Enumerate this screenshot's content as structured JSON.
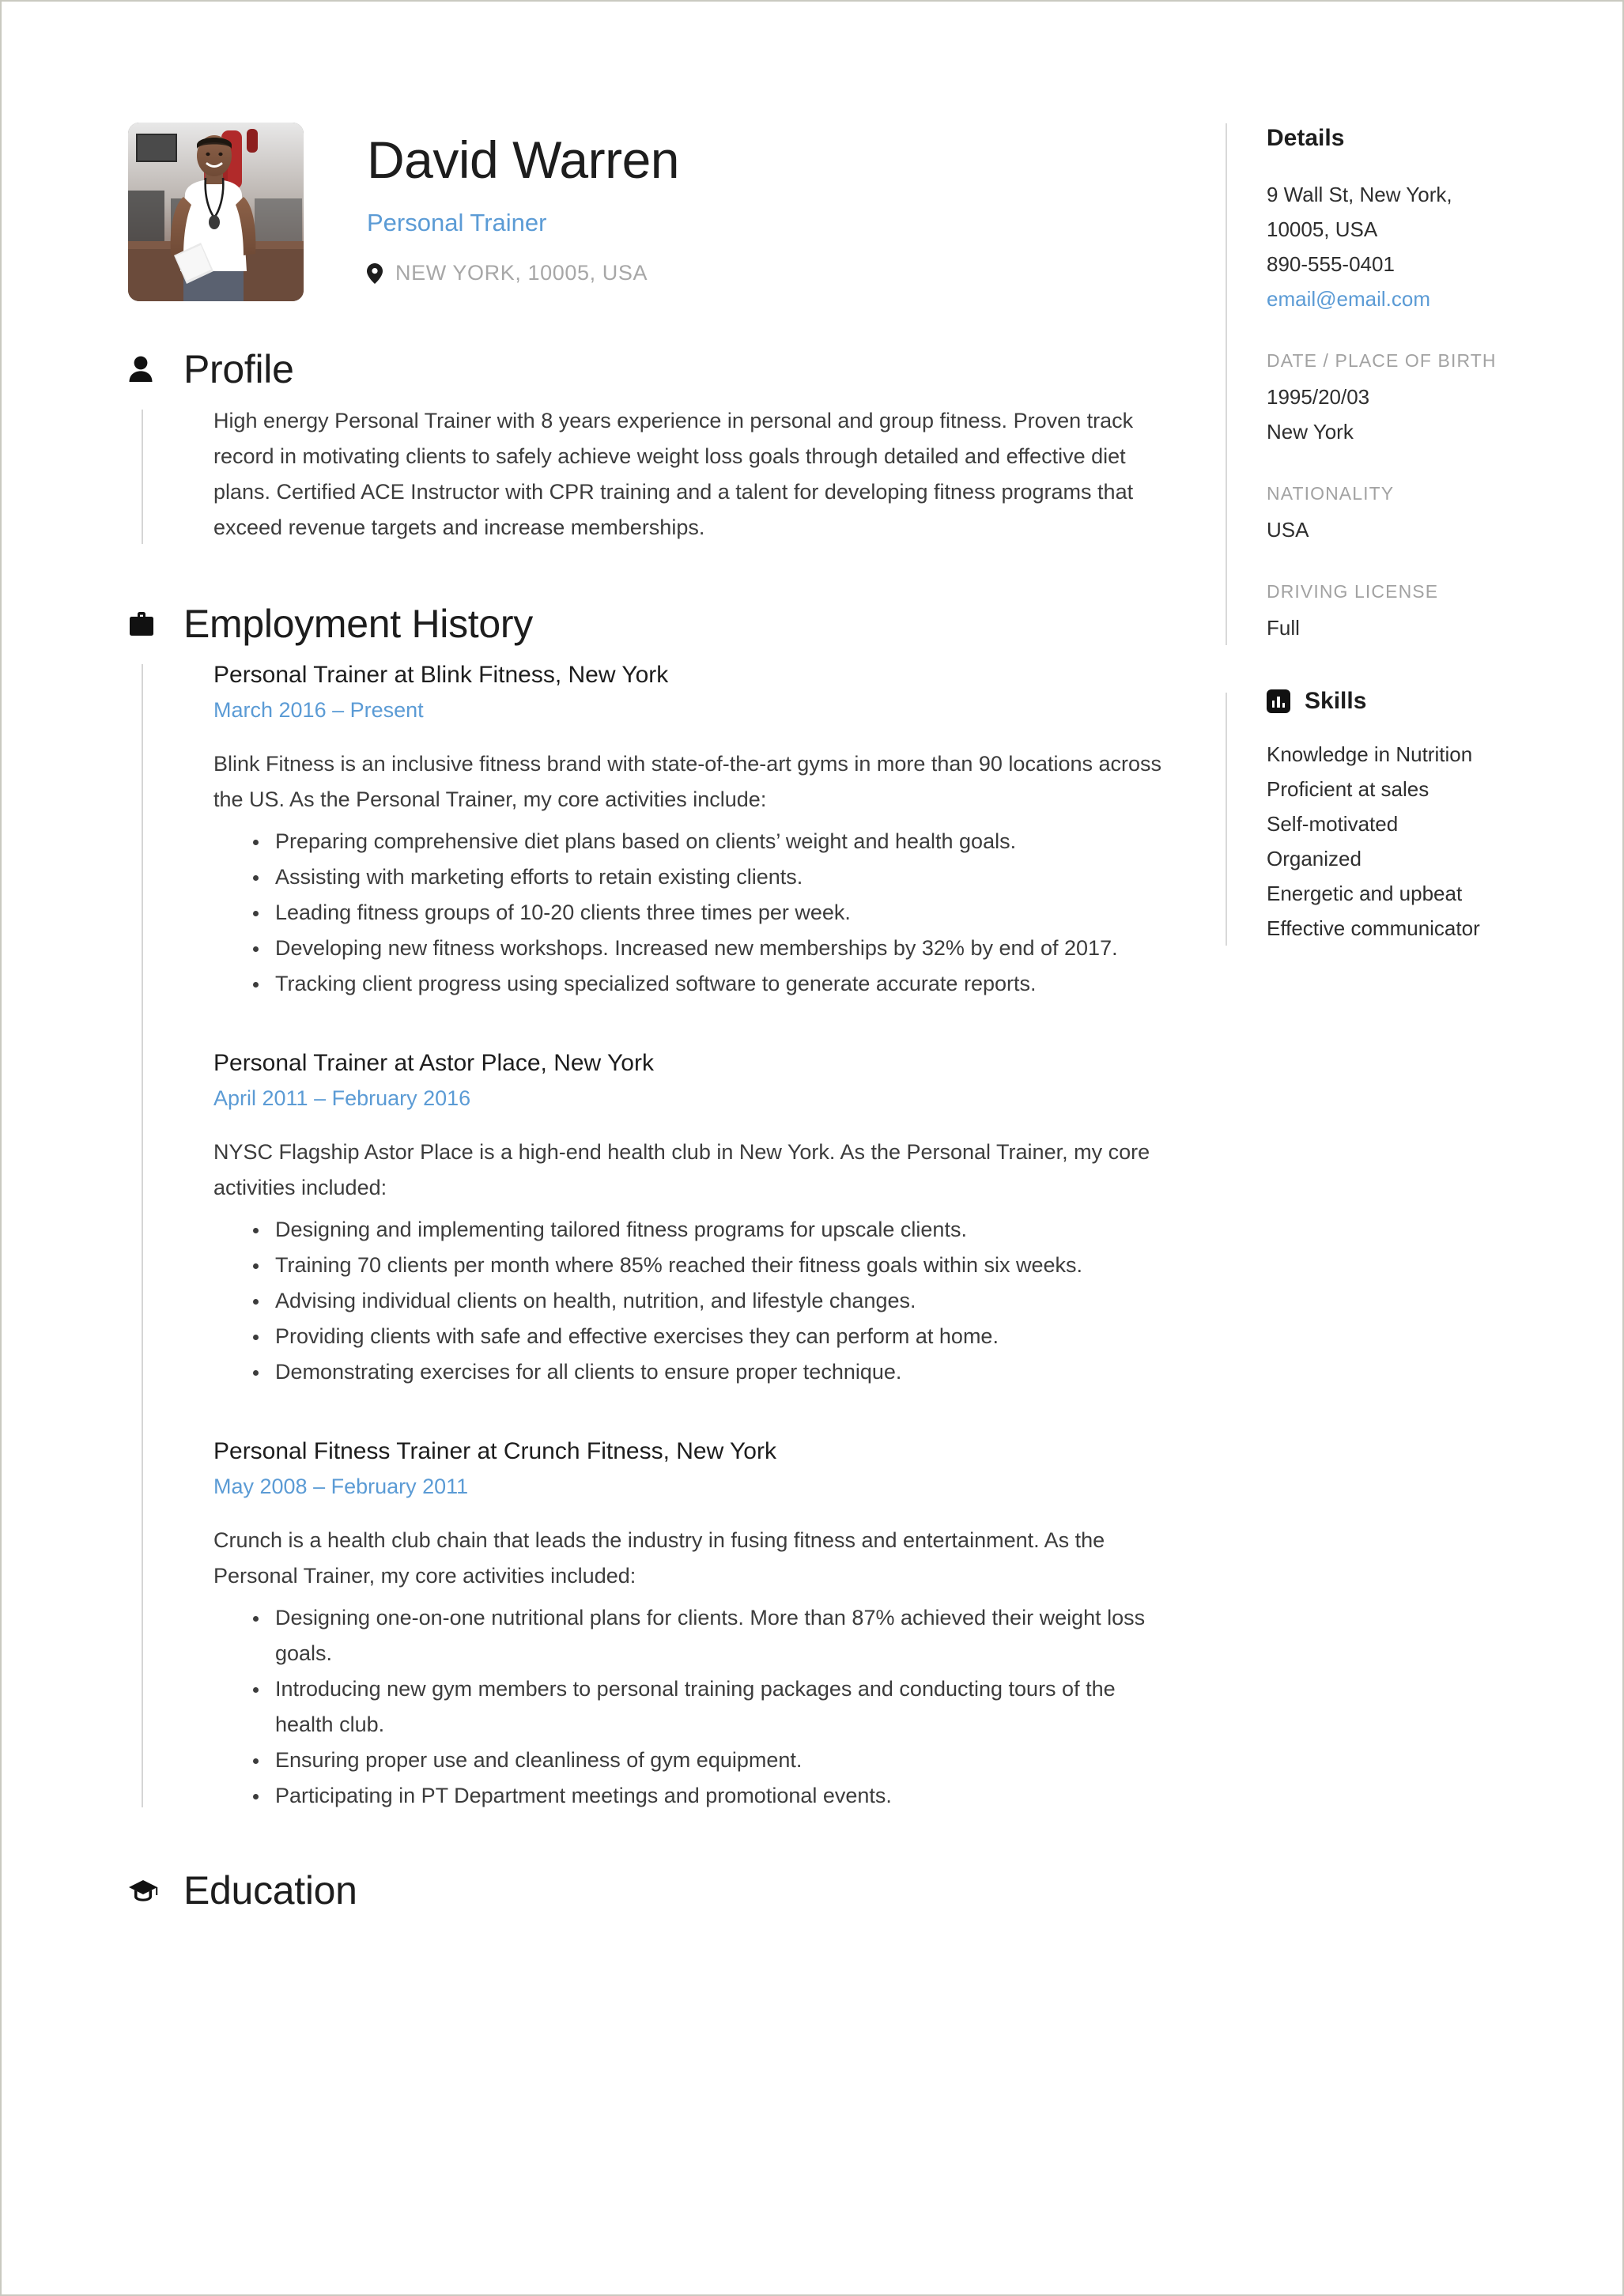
{
  "header": {
    "full_name": "David Warren",
    "job_title": "Personal Trainer",
    "location": "NEW YORK, 10005, USA",
    "pin_icon": "location-pin-icon",
    "avatar_alt": "photo of man in white t-shirt in a gym"
  },
  "profile": {
    "section_title": "Profile",
    "icon": "person-icon",
    "text": "High energy Personal Trainer with 8 years experience in personal and group fitness. Proven track record in motivating clients to safely achieve weight loss goals through detailed and effective diet plans. Certified ACE Instructor with CPR training and a talent for developing fitness programs that exceed revenue targets and increase memberships."
  },
  "employment": {
    "section_title": "Employment History",
    "icon": "briefcase-icon",
    "jobs": [
      {
        "title": "Personal Trainer at Blink Fitness, New York",
        "dates": "March 2016  –  Present",
        "description": "Blink Fitness is an inclusive fitness brand with state-of-the-art gyms in more than 90 locations across the US. As the Personal Trainer, my core activities include:",
        "bullets": [
          "Preparing comprehensive diet plans based on clients’ weight and health goals.",
          "Assisting with marketing efforts to retain existing clients.",
          "Leading fitness groups of 10-20 clients three times per week.",
          "Developing new fitness workshops. Increased new memberships by 32% by end of 2017.",
          "Tracking client progress using specialized software to generate accurate reports."
        ]
      },
      {
        "title": "Personal Trainer at Astor Place, New York",
        "dates": "April 2011  –  February 2016",
        "description": "NYSC Flagship Astor Place is a high-end health club in New York. As the Personal Trainer, my core activities included:",
        "bullets": [
          "Designing and implementing tailored fitness programs for upscale clients.",
          "Training 70 clients per month where 85% reached their fitness goals within six weeks.",
          "Advising individual clients on health, nutrition, and lifestyle changes.",
          "Providing clients with safe and effective exercises they can perform at home.",
          "Demonstrating exercises for all clients to ensure proper technique."
        ]
      },
      {
        "title": "Personal Fitness Trainer at Crunch Fitness, New York",
        "dates": "May 2008  –  February 2011",
        "description": "Crunch is a health club chain that leads the industry in fusing fitness and entertainment. As the Personal Trainer, my core activities included:",
        "bullets": [
          "Designing one-on-one nutritional plans for clients. More than 87% achieved their weight loss goals.",
          "Introducing new gym members to personal training packages and conducting tours of the health club.",
          "Ensuring proper use and cleanliness of gym equipment.",
          "Participating in PT Department meetings and promotional events."
        ]
      }
    ]
  },
  "education": {
    "section_title": "Education",
    "icon": "graduation-cap-icon"
  },
  "sidebar": {
    "details": {
      "title": "Details",
      "address_line1": "9 Wall St, New York,",
      "address_line2": "10005, USA",
      "phone": "890-555-0401",
      "email": "email@email.com",
      "dob_label": "DATE / PLACE OF BIRTH",
      "dob_date": "1995/20/03",
      "dob_place": "New York",
      "nationality_label": "NATIONALITY",
      "nationality_value": "USA",
      "license_label": "DRIVING LICENSE",
      "license_value": "Full"
    },
    "skills": {
      "title": "Skills",
      "icon": "bar-chart-icon",
      "items": [
        "Knowledge in Nutrition",
        "Proficient at sales",
        "Self-motivated",
        "Organized",
        "Energetic and upbeat",
        "Effective communicator"
      ]
    }
  },
  "colors": {
    "accent": "#5b9bd5",
    "text": "#3c3c3c",
    "heading": "#1d1d1d",
    "muted": "#a2a2a2",
    "rule": "#d5d5d5"
  }
}
